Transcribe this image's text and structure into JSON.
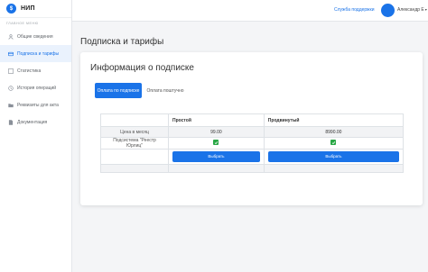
{
  "brand": {
    "name": "НИП",
    "logo_letter": "$"
  },
  "sidebar": {
    "heading": "ГЛАВНОЕ МЕНЮ",
    "items": [
      {
        "label": "Общие сведения",
        "icon": "user-icon"
      },
      {
        "label": "Подписка и тарифы",
        "icon": "card-icon"
      },
      {
        "label": "Статистика",
        "icon": "stats-icon"
      },
      {
        "label": "История операций",
        "icon": "history-icon"
      },
      {
        "label": "Реквизиты для акта",
        "icon": "folder-icon"
      },
      {
        "label": "Документация",
        "icon": "document-icon"
      }
    ],
    "active_index": 1
  },
  "topbar": {
    "support_label": "Служба поддержки",
    "user_name": "Александр Е",
    "accent": "#1a73e8"
  },
  "page": {
    "title": "Подписка и тарифы"
  },
  "card": {
    "title": "Информация о подписке",
    "tabs": [
      "Оплата по подписке",
      "Оплата поштучно"
    ],
    "active_tab": 0
  },
  "table": {
    "columns": [
      "",
      "Простой",
      "Продвинутый"
    ],
    "rows": [
      {
        "label": "Цена в месяц",
        "values": [
          "99.00",
          "8990.00"
        ]
      },
      {
        "label": "Подсистема \"Реестр Юрлиц\"",
        "values": [
          "check",
          "check"
        ]
      }
    ],
    "button_label": "Выбрать"
  }
}
